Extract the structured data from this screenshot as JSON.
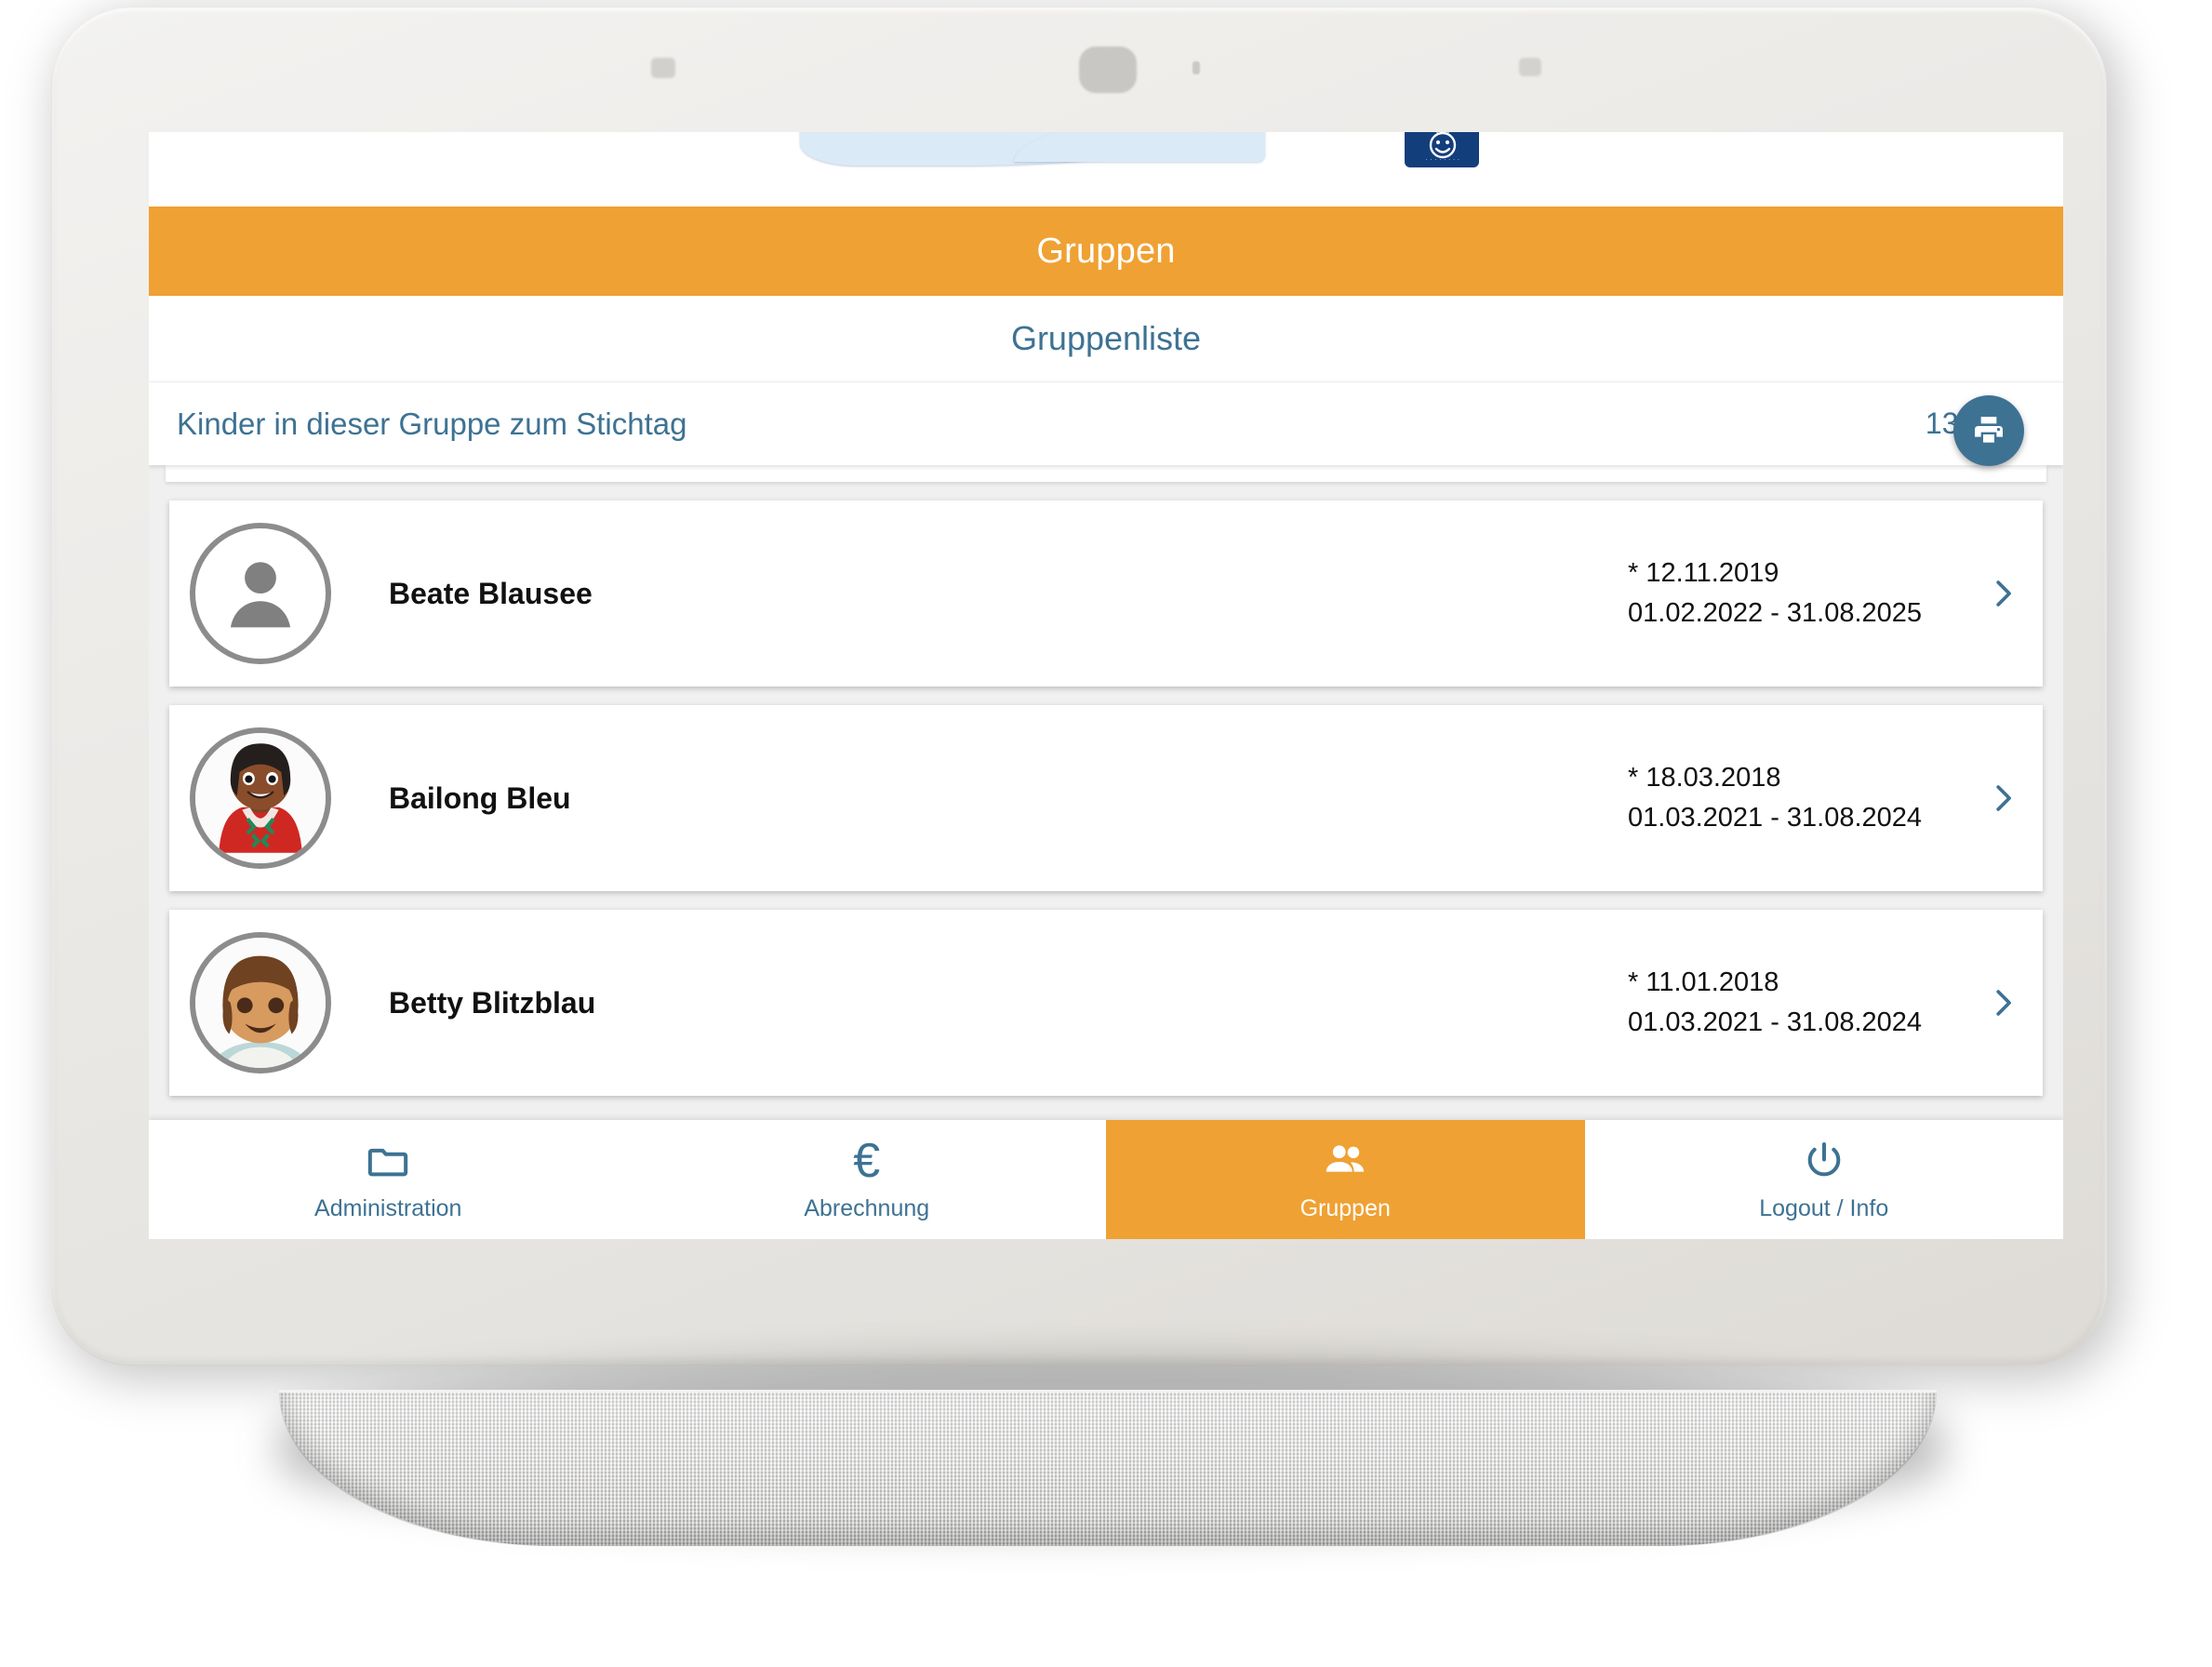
{
  "device": {
    "type": "smart-display",
    "frame_color": "#ebe9e6",
    "base_color": "#cfcecc"
  },
  "brand": {
    "logo_alt": "kita-logo",
    "badge_color": "#133e7c",
    "wave_color": "#dbeaf7"
  },
  "theme": {
    "accent_orange": "#efa133",
    "accent_blue": "#3d7293",
    "text_dark": "#111111",
    "list_bg": "#f0f0f0"
  },
  "header": {
    "title": "Gruppen"
  },
  "subnav": {
    "link_label": "Gruppenliste"
  },
  "section": {
    "title": "Kinder in dieser Gruppe zum Stichtag",
    "count": "13/13",
    "print_icon": "printer-icon",
    "print_label": "Drucken"
  },
  "children": [
    {
      "name": "Beate Blausee",
      "birth": "* 12.11.2019",
      "period": "01.02.2022 - 31.08.2025",
      "avatar": "placeholder-person",
      "chevron": "chevron-right-icon"
    },
    {
      "name": "Bailong Bleu",
      "birth": "* 18.03.2018",
      "period": "01.03.2021 - 31.08.2024",
      "avatar": "photo-dark-hair-red-jacket",
      "chevron": "chevron-right-icon"
    },
    {
      "name": "Betty Blitzblau",
      "birth": "* 11.01.2018",
      "period": "01.03.2021 - 31.08.2024",
      "avatar": "photo-brown-bob-hair",
      "chevron": "chevron-right-icon"
    }
  ],
  "bottom_nav": {
    "items": [
      {
        "label": "Administration",
        "icon": "folder-icon",
        "active": false
      },
      {
        "label": "Abrechnung",
        "icon": "euro-icon",
        "active": false
      },
      {
        "label": "Gruppen",
        "icon": "people-icon",
        "active": true
      },
      {
        "label": "Logout / Info",
        "icon": "power-icon",
        "active": false
      }
    ]
  }
}
